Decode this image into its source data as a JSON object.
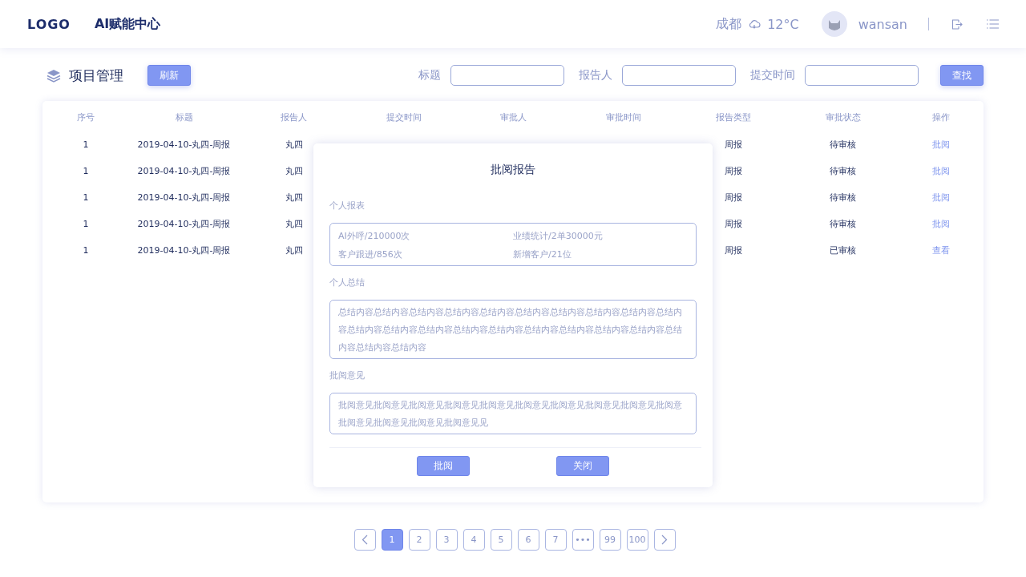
{
  "header": {
    "logo": "LOGO",
    "app_title": "AI赋能中心",
    "city": "成都",
    "temperature": "12°C",
    "username": "wansan"
  },
  "toolbar": {
    "section_title": "项目管理",
    "refresh_button": "刷新",
    "filters": [
      {
        "label": "标题"
      },
      {
        "label": "报告人"
      },
      {
        "label": "提交时间"
      }
    ],
    "search_button": "查找"
  },
  "table": {
    "columns": [
      "序号",
      "标题",
      "报告人",
      "提交时间",
      "审批人",
      "审批时间",
      "报告类型",
      "审批状态",
      "操作"
    ],
    "rows": [
      {
        "index": "1",
        "title": "2019-04-10-丸四-周报",
        "reporter": "丸四",
        "report_type": "周报",
        "status": "待审核",
        "action": "批阅"
      },
      {
        "index": "1",
        "title": "2019-04-10-丸四-周报",
        "reporter": "丸四",
        "report_type": "周报",
        "status": "待审核",
        "action": "批阅"
      },
      {
        "index": "1",
        "title": "2019-04-10-丸四-周报",
        "reporter": "丸四",
        "report_type": "周报",
        "status": "待审核",
        "action": "批阅"
      },
      {
        "index": "1",
        "title": "2019-04-10-丸四-周报",
        "reporter": "丸四",
        "report_type": "周报",
        "status": "待审核",
        "action": "批阅"
      },
      {
        "index": "1",
        "title": "2019-04-10-丸四-周报",
        "reporter": "丸四",
        "report_type": "周报",
        "status": "已审核",
        "action": "查看"
      }
    ]
  },
  "modal": {
    "title": "批阅报告",
    "report_label": "个人报表",
    "stats": [
      "AI外呼/210000次",
      "业绩统计/2单30000元",
      "客户跟进/856次",
      "新增客户/21位"
    ],
    "summary_label": "个人总结",
    "summary": "总结内容总结内容总结内容总结内容总结内容总结内容总结内容总结内容总结内容总结内容总结内容总结内容总结内容总结内容总结内容总结内容总结内容总结内容总结内容总结内容总结内容总结内容",
    "comment_label": "批阅意见",
    "comment": "批阅意见批阅意见批阅意见批阅意见批阅意见批阅意见批阅意见批阅意见批阅意见批阅意批阅意见批阅意见批阅意见批阅意见见",
    "buttons": [
      "批阅",
      "关闭"
    ]
  },
  "pagination": {
    "pages": [
      {
        "label": "1",
        "selected": true
      },
      {
        "label": "2",
        "selected": false
      },
      {
        "label": "3",
        "selected": false
      },
      {
        "label": "4",
        "selected": false
      },
      {
        "label": "5",
        "selected": false
      },
      {
        "label": "6",
        "selected": false
      },
      {
        "label": "7",
        "selected": false
      },
      {
        "label": "•••",
        "selected": false
      },
      {
        "label": "99",
        "selected": false
      },
      {
        "label": "100",
        "selected": false
      }
    ]
  }
}
